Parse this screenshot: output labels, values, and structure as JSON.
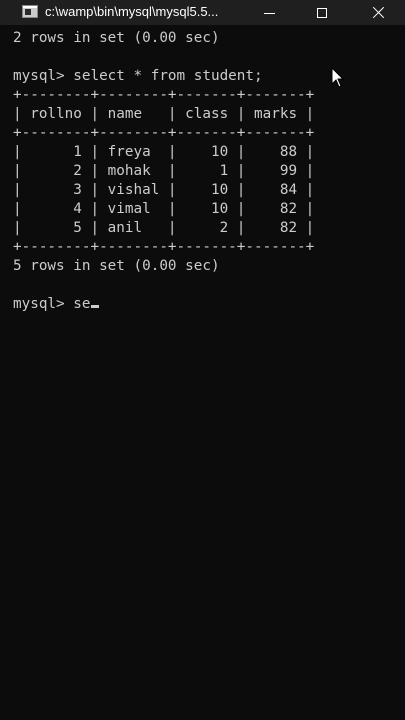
{
  "window": {
    "title": "c:\\wamp\\bin\\mysql\\mysql5.5...",
    "controls": {
      "minimize": "minimize",
      "maximize": "maximize",
      "close": "close"
    }
  },
  "console": {
    "lines": [
      "2 rows in set (0.00 sec)",
      "",
      "mysql> select * from student;",
      "+--------+--------+-------+-------+",
      "| rollno | name   | class | marks |",
      "+--------+--------+-------+-------+",
      "|      1 | freya  |    10 |    88 |",
      "|      2 | mohak  |     1 |    99 |",
      "|      3 | vishal |    10 |    84 |",
      "|      4 | vimal  |    10 |    82 |",
      "|      5 | anil   |     2 |    82 |",
      "+--------+--------+-------+-------+",
      "5 rows in set (0.00 sec)",
      "",
      "mysql> se"
    ]
  },
  "colors": {
    "background": "#0c0c0c",
    "titlebar": "#1f1f1f",
    "text": "#cccccc"
  }
}
